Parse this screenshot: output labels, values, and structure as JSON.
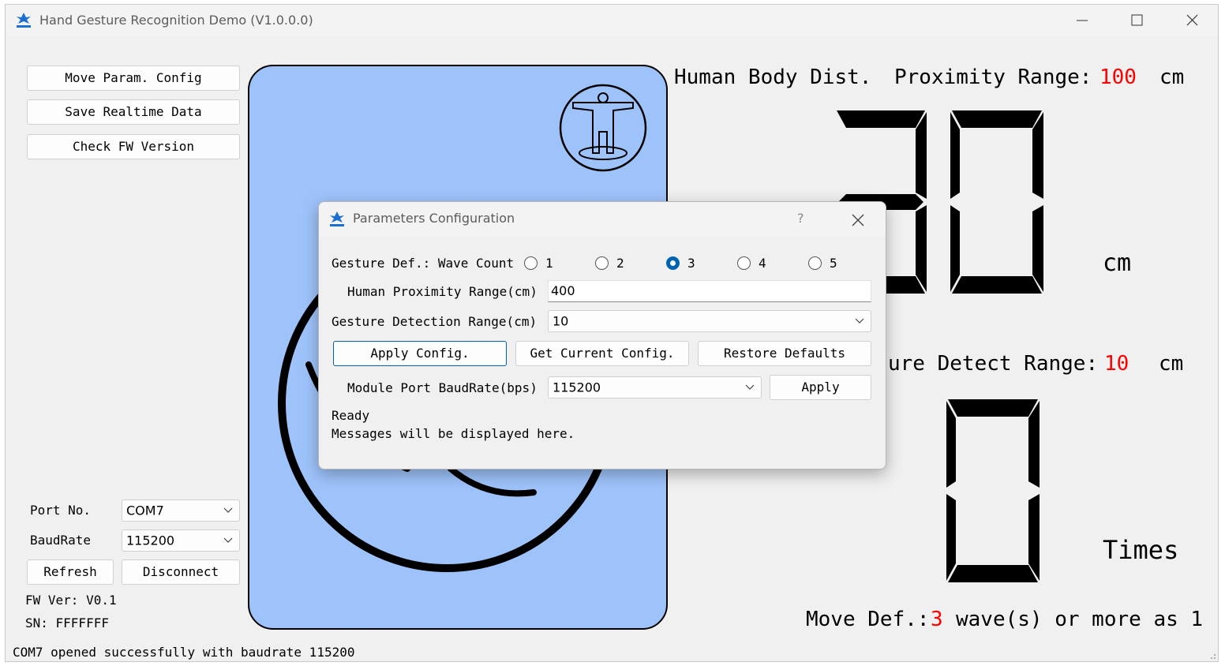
{
  "app": {
    "title": "Hand Gesture Recognition Demo (V1.0.0.0)"
  },
  "left_panel": {
    "move_param_btn": "Move Param. Config",
    "save_data_btn": "Save Realtime Data",
    "check_fw_btn": "Check FW Version",
    "port_label": "Port No.",
    "port_value": "COM7",
    "baud_label": "BaudRate",
    "baud_value": "115200",
    "refresh_btn": "Refresh",
    "disconnect_btn": "Disconnect",
    "fw_ver": "FW Ver: V0.1",
    "sn": "SN: FFFFFFF"
  },
  "status_bar": "COM7 opened successfully with baudrate 115200",
  "display": {
    "human_body_dist_label": "Human Body Dist.",
    "proximity_range_label": "Proximity Range:",
    "proximity_range_value": "100",
    "proximity_unit": "cm",
    "distance_unit": "cm",
    "gesture_range_label": "ure Detect Range:",
    "gesture_range_value": "10",
    "gesture_range_unit": "cm",
    "count_unit": "Times",
    "move_def_label": "Move Def.:",
    "move_def_value": "3",
    "move_def_suffix": "wave(s) or more as 1",
    "distance_digits": "30",
    "count_digits": "0"
  },
  "dialog": {
    "title": "Parameters Configuration",
    "help": "?",
    "gesture_def_label": "Gesture Def.: Wave Count",
    "wave_options": [
      "1",
      "2",
      "3",
      "4",
      "5"
    ],
    "wave_selected": "3",
    "human_range_label": "Human Proximity Range(cm)",
    "human_range_value": "400",
    "gesture_range_label": "Gesture Detection Range(cm)",
    "gesture_range_value": "10",
    "apply_config_btn": "Apply Config.",
    "get_config_btn": "Get Current Config.",
    "restore_btn": "Restore Defaults",
    "baud_label": "Module Port BaudRate(bps)",
    "baud_value": "115200",
    "apply_btn": "Apply",
    "status_line1": "Ready",
    "status_line2": "Messages will be displayed here."
  },
  "colors": {
    "panel_bg": "#9ec3fb",
    "highlight": "#ff0000",
    "radio_selected": "#0063b1"
  }
}
